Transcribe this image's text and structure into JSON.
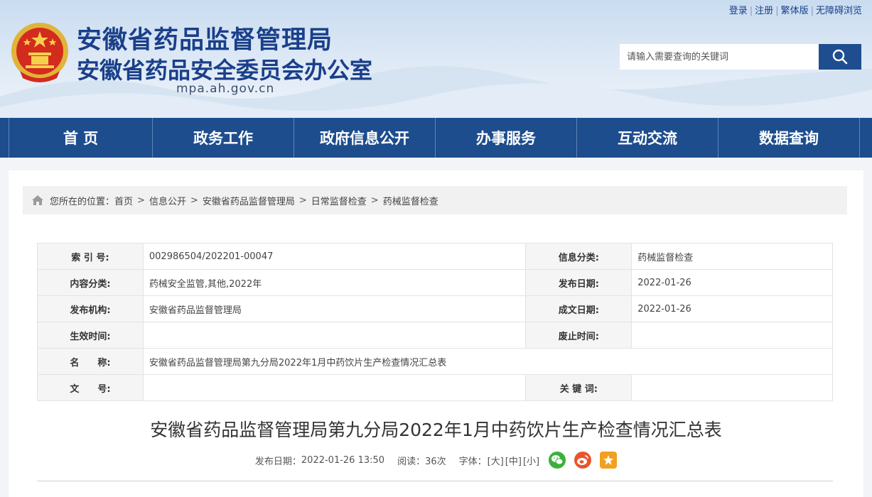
{
  "header": {
    "title_main": "安徽省药品监督管理局",
    "title_sub": "安徽省药品安全委员会办公室",
    "site_url": "mpa.ah.gov.cn",
    "top_links": [
      "登录",
      "注册",
      "繁体版",
      "无障碍浏览"
    ],
    "search_placeholder": "请输入需要查询的关键词",
    "icons": {
      "emblem": "national-emblem-icon",
      "search": "search-icon"
    },
    "colors": {
      "brand_blue": "#1a3f8a",
      "nav_blue": "#1d4d8d"
    }
  },
  "nav": {
    "items": [
      "首 页",
      "政务工作",
      "政府信息公开",
      "办事服务",
      "互动交流",
      "数据查询"
    ]
  },
  "breadcrumb": {
    "prefix": "您所在的位置：",
    "items": [
      "首页",
      "信息公开",
      "安徽省药品监督管理局",
      "日常监督检查",
      "药械监督检查"
    ],
    "separator": ">"
  },
  "meta": {
    "index_no_label": "索 引 号:",
    "index_no": "002986504/202201-00047",
    "info_category_label": "信息分类:",
    "info_category": "药械监督检查",
    "content_category_label": "内容分类:",
    "content_category": "药械安全监管,其他,2022年",
    "publish_date_label": "发布日期:",
    "publish_date": "2022-01-26",
    "publisher_label": "发布机构:",
    "publisher": "安徽省药品监督管理局",
    "creation_date_label": "成文日期:",
    "creation_date": "2022-01-26",
    "effective_label": "生效时间:",
    "effective": "",
    "expiry_label": "废止时间:",
    "expiry": "",
    "name_label": "名　　称:",
    "name": "安徽省药品监督管理局第九分局2022年1月中药饮片生产检查情况汇总表",
    "doc_no_label": "文　　号:",
    "doc_no": "",
    "keywords_label": "关 键 词:",
    "keywords": ""
  },
  "article": {
    "title": "安徽省药品监督管理局第九分局2022年1月中药饮片生产检查情况汇总表",
    "publish_label": "发布日期：",
    "publish_datetime": "2022-01-26 13:50",
    "views_label": "阅读：",
    "views": "36次",
    "font_label": "字体：",
    "font_large": "[大]",
    "font_medium": "[中]",
    "font_small": "[小]",
    "share_icons": [
      "wechat-icon",
      "weibo-icon",
      "favorite-star-icon"
    ]
  }
}
